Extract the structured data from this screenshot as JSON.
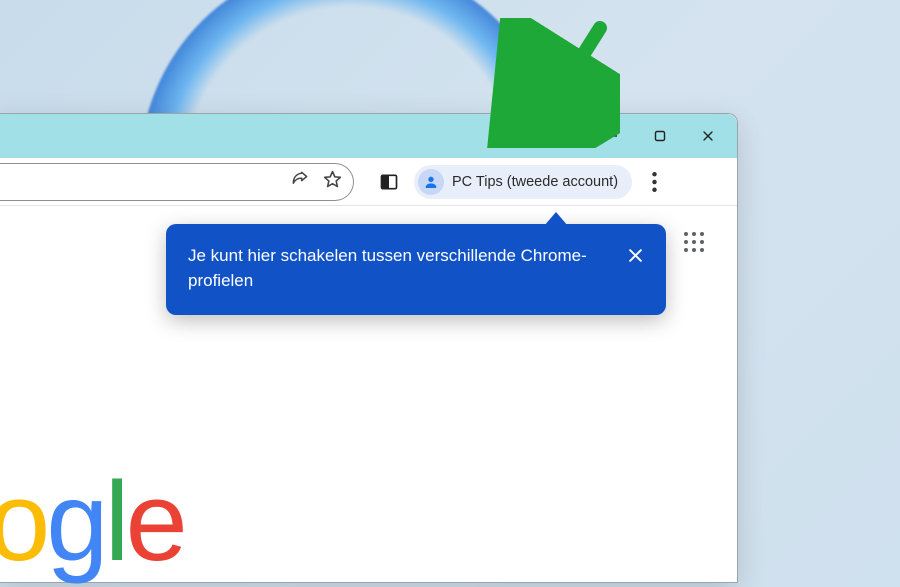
{
  "profile": {
    "name": "PC Tips (tweede account)"
  },
  "tooltip": {
    "message": "Je kunt hier schakelen tussen verschillende Chrome-profielen"
  },
  "logo": {
    "l1": "o",
    "l2": "g",
    "l3": "l",
    "l4": "e"
  }
}
